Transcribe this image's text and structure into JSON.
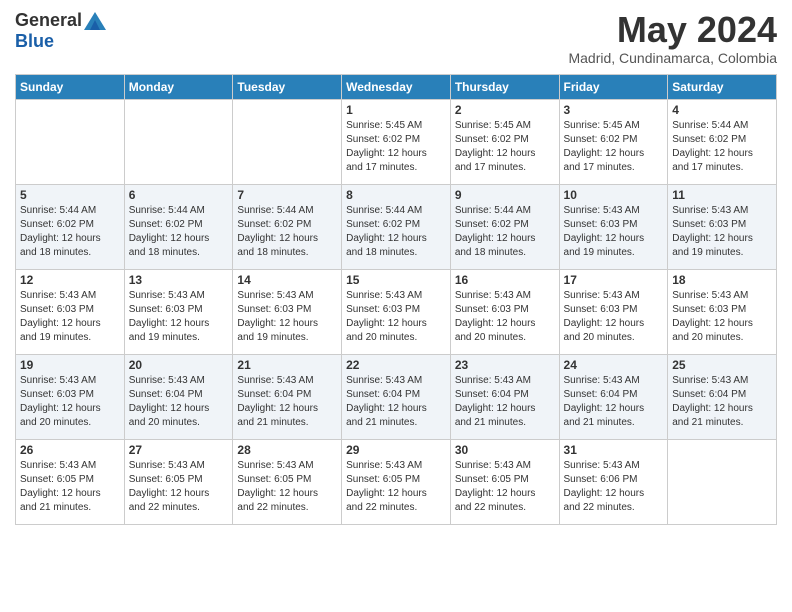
{
  "header": {
    "logo": {
      "general": "General",
      "blue": "Blue"
    },
    "title": "May 2024",
    "location": "Madrid, Cundinamarca, Colombia"
  },
  "calendar": {
    "headers": [
      "Sunday",
      "Monday",
      "Tuesday",
      "Wednesday",
      "Thursday",
      "Friday",
      "Saturday"
    ],
    "weeks": [
      [
        {
          "day": "",
          "info": ""
        },
        {
          "day": "",
          "info": ""
        },
        {
          "day": "",
          "info": ""
        },
        {
          "day": "1",
          "info": "Sunrise: 5:45 AM\nSunset: 6:02 PM\nDaylight: 12 hours\nand 17 minutes."
        },
        {
          "day": "2",
          "info": "Sunrise: 5:45 AM\nSunset: 6:02 PM\nDaylight: 12 hours\nand 17 minutes."
        },
        {
          "day": "3",
          "info": "Sunrise: 5:45 AM\nSunset: 6:02 PM\nDaylight: 12 hours\nand 17 minutes."
        },
        {
          "day": "4",
          "info": "Sunrise: 5:44 AM\nSunset: 6:02 PM\nDaylight: 12 hours\nand 17 minutes."
        }
      ],
      [
        {
          "day": "5",
          "info": "Sunrise: 5:44 AM\nSunset: 6:02 PM\nDaylight: 12 hours\nand 18 minutes."
        },
        {
          "day": "6",
          "info": "Sunrise: 5:44 AM\nSunset: 6:02 PM\nDaylight: 12 hours\nand 18 minutes."
        },
        {
          "day": "7",
          "info": "Sunrise: 5:44 AM\nSunset: 6:02 PM\nDaylight: 12 hours\nand 18 minutes."
        },
        {
          "day": "8",
          "info": "Sunrise: 5:44 AM\nSunset: 6:02 PM\nDaylight: 12 hours\nand 18 minutes."
        },
        {
          "day": "9",
          "info": "Sunrise: 5:44 AM\nSunset: 6:02 PM\nDaylight: 12 hours\nand 18 minutes."
        },
        {
          "day": "10",
          "info": "Sunrise: 5:43 AM\nSunset: 6:03 PM\nDaylight: 12 hours\nand 19 minutes."
        },
        {
          "day": "11",
          "info": "Sunrise: 5:43 AM\nSunset: 6:03 PM\nDaylight: 12 hours\nand 19 minutes."
        }
      ],
      [
        {
          "day": "12",
          "info": "Sunrise: 5:43 AM\nSunset: 6:03 PM\nDaylight: 12 hours\nand 19 minutes."
        },
        {
          "day": "13",
          "info": "Sunrise: 5:43 AM\nSunset: 6:03 PM\nDaylight: 12 hours\nand 19 minutes."
        },
        {
          "day": "14",
          "info": "Sunrise: 5:43 AM\nSunset: 6:03 PM\nDaylight: 12 hours\nand 19 minutes."
        },
        {
          "day": "15",
          "info": "Sunrise: 5:43 AM\nSunset: 6:03 PM\nDaylight: 12 hours\nand 20 minutes."
        },
        {
          "day": "16",
          "info": "Sunrise: 5:43 AM\nSunset: 6:03 PM\nDaylight: 12 hours\nand 20 minutes."
        },
        {
          "day": "17",
          "info": "Sunrise: 5:43 AM\nSunset: 6:03 PM\nDaylight: 12 hours\nand 20 minutes."
        },
        {
          "day": "18",
          "info": "Sunrise: 5:43 AM\nSunset: 6:03 PM\nDaylight: 12 hours\nand 20 minutes."
        }
      ],
      [
        {
          "day": "19",
          "info": "Sunrise: 5:43 AM\nSunset: 6:03 PM\nDaylight: 12 hours\nand 20 minutes."
        },
        {
          "day": "20",
          "info": "Sunrise: 5:43 AM\nSunset: 6:04 PM\nDaylight: 12 hours\nand 20 minutes."
        },
        {
          "day": "21",
          "info": "Sunrise: 5:43 AM\nSunset: 6:04 PM\nDaylight: 12 hours\nand 21 minutes."
        },
        {
          "day": "22",
          "info": "Sunrise: 5:43 AM\nSunset: 6:04 PM\nDaylight: 12 hours\nand 21 minutes."
        },
        {
          "day": "23",
          "info": "Sunrise: 5:43 AM\nSunset: 6:04 PM\nDaylight: 12 hours\nand 21 minutes."
        },
        {
          "day": "24",
          "info": "Sunrise: 5:43 AM\nSunset: 6:04 PM\nDaylight: 12 hours\nand 21 minutes."
        },
        {
          "day": "25",
          "info": "Sunrise: 5:43 AM\nSunset: 6:04 PM\nDaylight: 12 hours\nand 21 minutes."
        }
      ],
      [
        {
          "day": "26",
          "info": "Sunrise: 5:43 AM\nSunset: 6:05 PM\nDaylight: 12 hours\nand 21 minutes."
        },
        {
          "day": "27",
          "info": "Sunrise: 5:43 AM\nSunset: 6:05 PM\nDaylight: 12 hours\nand 22 minutes."
        },
        {
          "day": "28",
          "info": "Sunrise: 5:43 AM\nSunset: 6:05 PM\nDaylight: 12 hours\nand 22 minutes."
        },
        {
          "day": "29",
          "info": "Sunrise: 5:43 AM\nSunset: 6:05 PM\nDaylight: 12 hours\nand 22 minutes."
        },
        {
          "day": "30",
          "info": "Sunrise: 5:43 AM\nSunset: 6:05 PM\nDaylight: 12 hours\nand 22 minutes."
        },
        {
          "day": "31",
          "info": "Sunrise: 5:43 AM\nSunset: 6:06 PM\nDaylight: 12 hours\nand 22 minutes."
        },
        {
          "day": "",
          "info": ""
        }
      ]
    ]
  }
}
